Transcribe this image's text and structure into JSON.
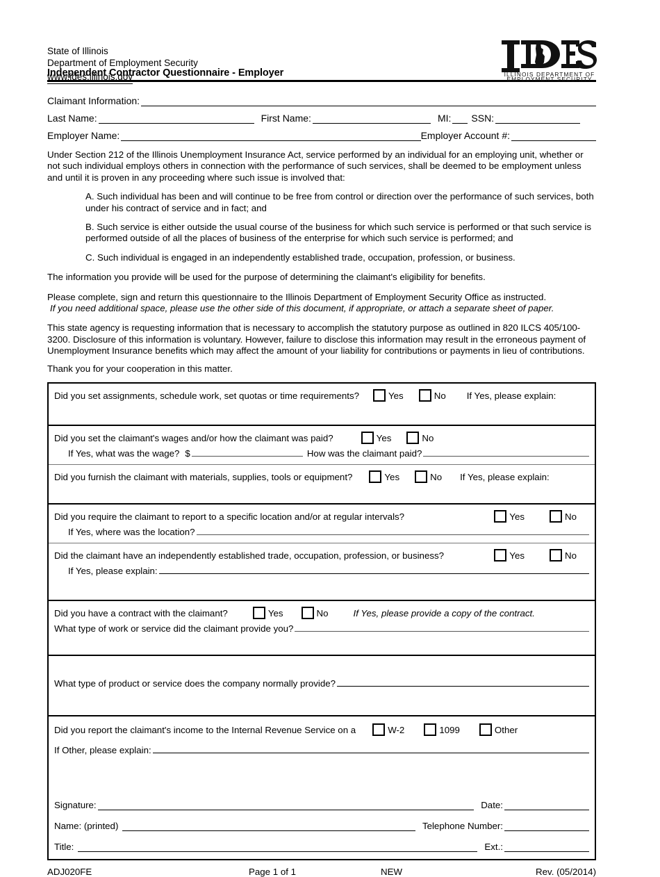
{
  "header": {
    "state_line": "State of Illinois",
    "dept_line": "Department of Employment Security",
    "website": "www.ides.illinois.gov",
    "logo_mark": "IDES",
    "logo_sub_line1": "ILLINOIS DEPARTMENT OF",
    "logo_sub_line2": "EMPLOYMENT SECURITY",
    "doc_title": "Independent Contractor Questionnaire - Employer"
  },
  "claimant": {
    "info_label": "Claimant Information:",
    "last_name_label": "Last Name:",
    "first_name_label": "First Name:",
    "mi_label": "MI:",
    "ssn_label": "SSN:",
    "employer_name_label": "Employer Name:",
    "employer_account_label": "Employer Account #:",
    "last_name_value": "",
    "first_name_value": "",
    "mi_value": "",
    "ssn_value": "",
    "employer_name_value": "",
    "employer_account_value": ""
  },
  "body": {
    "intro": "Under Section 212 of the Illinois Unemployment Insurance Act, service performed by an individual for an employing unit, whether or not such individual employs others in connection with the performance of such services, shall be deemed to be employment unless and until it is proven in any proceeding where such issue is involved that:",
    "clause_a": "A. Such individual has been and will continue to be free from control or direction over the performance of such services, both under his contract of service and in fact; and",
    "clause_b": "B. Such service is either outside the usual course of the business for which such service is performed or that such service is performed outside of all the places of business of the enterprise for which such service is performed; and",
    "clause_c": "C. Such individual is engaged in an independently established trade, occupation, profession, or business.",
    "purpose": "The information you provide will be used for the purpose of determining the claimant's eligibility for benefits.",
    "instructions": "Please complete, sign and return this questionnaire to the Illinois Department of Employment Security Office as instructed.",
    "instructions_italic": "If you need additional space, please use the other side of this document, if appropriate, or attach a separate sheet of paper.",
    "privacy": "This state agency is requesting information that is necessary to accomplish the statutory purpose as outlined in 820 ILCS 405/100-3200. Disclosure of this information is voluntary. However, failure to disclose this information may result in the erroneous payment of Unemployment Insurance benefits which may affect the amount of your liability for contributions or payments in lieu of contributions.",
    "thanks": "Thank you for your cooperation in this matter."
  },
  "questions": {
    "q1_text": "Did you set assignments, schedule work, set quotas or time requirements?",
    "q1_yes": "Yes",
    "q1_no": "No",
    "q1_explain": "If Yes, please explain:",
    "q2_text": "Did you set the claimant's wages and/or how the claimant was paid?",
    "q2_yes": "Yes",
    "q2_no": "No",
    "q2_wage_label": "If Yes, what was the wage?",
    "q2_dollar": "$",
    "q2_paid_label": "How was the claimant paid?",
    "q3_text": "Did you furnish the claimant with materials, supplies, tools or equipment?",
    "q3_yes": "Yes",
    "q3_no": "No",
    "q3_explain": "If Yes, please explain:",
    "q4_text": "Did you require the claimant to report to a specific location and/or at regular intervals?",
    "q4_yes": "Yes",
    "q4_no": "No",
    "q4_location_label": "If Yes, where was the location?",
    "q5_text": "Did the claimant have an independently established trade, occupation, profession, or business?",
    "q5_yes": "Yes",
    "q5_no": "No",
    "q5_explain_label": "If Yes, please explain:",
    "q6_text": "Did you have a contract with the claimant?",
    "q6_yes": "Yes",
    "q6_no": "No",
    "q6_note": "If Yes, please provide a copy of the contract.",
    "q7_text": "What type of work or service did the claimant provide you?",
    "q8_text": "What type of product or service does the company normally provide?",
    "q9_text": "Did you report the claimant's income to the Internal Revenue Service on a",
    "q9_opt1": "W-2",
    "q9_opt2": "1099",
    "q9_opt3": "Other",
    "q9_other_label": "If Other, please explain:"
  },
  "signature": {
    "signature_label": "Signature:",
    "date_label": "Date:",
    "name_label": "Name: (printed)",
    "phone_label": "Telephone Number:",
    "title_label": "Title:",
    "ext_label": "Ext.:"
  },
  "footer": {
    "form_id": "ADJ020FE",
    "page": "Page 1 of 1",
    "status": "NEW",
    "revision": "Rev. (05/2014)"
  }
}
